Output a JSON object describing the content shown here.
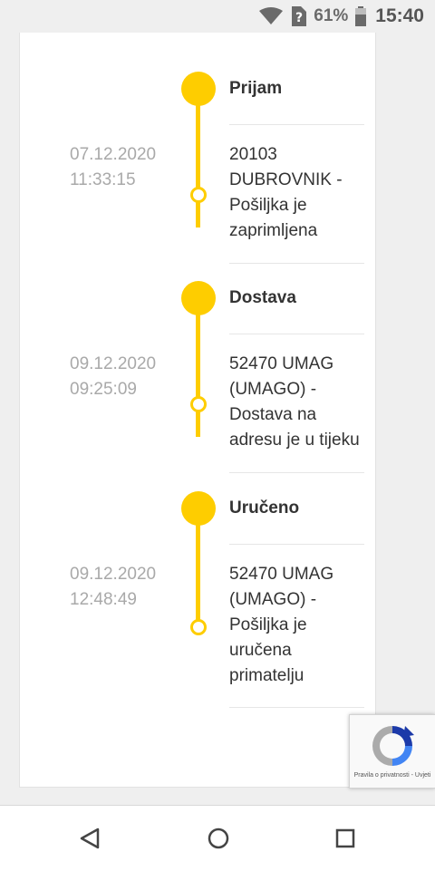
{
  "status_bar": {
    "battery_percent": "61%",
    "time": "15:40",
    "icons": [
      "wifi-icon",
      "no-sim-icon",
      "battery-icon"
    ]
  },
  "timeline": {
    "accent_color": "#fecd00",
    "stages": [
      {
        "title": "Prijam",
        "events": [
          {
            "date": "07.12.2020",
            "time": "11:33:15",
            "lines": [
              "20103",
              "DUBROVNIK -",
              "Pošiljka je",
              "zaprimljena"
            ]
          }
        ]
      },
      {
        "title": "Dostava",
        "events": [
          {
            "date": "09.12.2020",
            "time": "09:25:09",
            "lines": [
              "52470 UMAG",
              "(UMAGO) -",
              "Dostava na",
              "adresu je u tijeku"
            ]
          }
        ]
      },
      {
        "title": "Uručeno",
        "events": [
          {
            "date": "09.12.2020",
            "time": "12:48:49",
            "lines": [
              "52470 UMAG",
              "(UMAGO) -",
              "Pošiljka je",
              "uručena",
              "primatelju"
            ]
          }
        ]
      }
    ]
  },
  "recaptcha": {
    "privacy": "Pravila o privatnosti",
    "separator": " - ",
    "terms": "Uvjeti"
  },
  "nav_bar": {
    "buttons": [
      "back-button",
      "home-button",
      "recents-button"
    ]
  }
}
